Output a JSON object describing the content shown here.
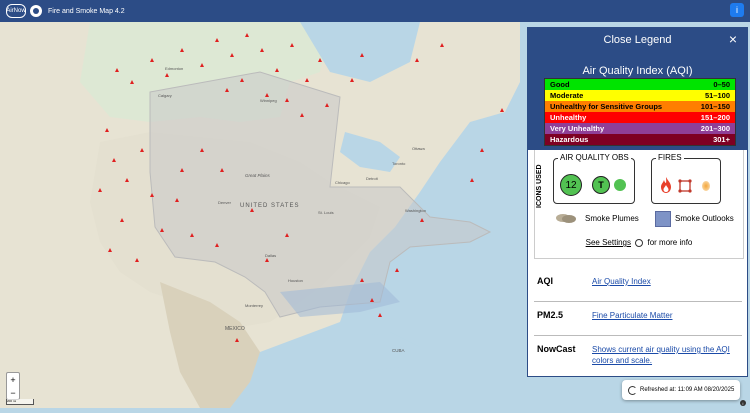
{
  "header": {
    "logo_text": "AirNow",
    "title": "Fire and Smoke Map 4.2",
    "info_label": "i"
  },
  "map": {
    "labels": [
      {
        "text": "UNITED STATES"
      },
      {
        "text": "Great Plains"
      },
      {
        "text": "MEXICO"
      },
      {
        "text": "CUBA"
      },
      {
        "text": "Edmonton"
      },
      {
        "text": "Calgary"
      },
      {
        "text": "Winnipeg"
      },
      {
        "text": "Chicago"
      },
      {
        "text": "Detroit"
      },
      {
        "text": "Toronto"
      },
      {
        "text": "Ottawa"
      },
      {
        "text": "St. Louis"
      },
      {
        "text": "Denver"
      },
      {
        "text": "Washington"
      },
      {
        "text": "Dallas"
      },
      {
        "text": "Houston"
      },
      {
        "text": "Monterrey"
      }
    ],
    "zoom_in": "+",
    "zoom_out": "−",
    "scale_label": "200 mi"
  },
  "legend": {
    "close_title": "Close Legend",
    "close_icon": "close-icon",
    "aqi_title": "Air Quality Index (AQI)",
    "aqi_levels": [
      {
        "label": "Good",
        "range": "0–50",
        "color": "#00e400",
        "text": "#000"
      },
      {
        "label": "Moderate",
        "range": "51–100",
        "color": "#ffff00",
        "text": "#000"
      },
      {
        "label": "Unhealthy for Sensitive Groups",
        "range": "101–150",
        "color": "#ff7e00",
        "text": "#000"
      },
      {
        "label": "Unhealthy",
        "range": "151–200",
        "color": "#ff0000",
        "text": "#fff"
      },
      {
        "label": "Very Unhealthy",
        "range": "201–300",
        "color": "#8f3f97",
        "text": "#fff"
      },
      {
        "label": "Hazardous",
        "range": "301+",
        "color": "#7e0023",
        "text": "#fff"
      }
    ],
    "icons_used": "ICONS USED",
    "aq_obs_title": "AIR QUALITY OBS",
    "aq_obs_value": "12",
    "aq_obs_t": "T",
    "fires_title": "FIRES",
    "smoke_plumes": "Smoke Plumes",
    "smoke_outlooks": "Smoke Outlooks",
    "settings_pre": "See Settings",
    "settings_post": "for more info",
    "definitions": [
      {
        "term": "AQI",
        "link": "Air Quality Index"
      },
      {
        "term": "PM2.5",
        "link": "Fine Particulate Matter"
      },
      {
        "term": "NowCast",
        "link": "Shows current air quality using the AQI colors and scale."
      }
    ]
  },
  "refresh_text": "Refreshed at: 11:09 AM 08/20/2025"
}
